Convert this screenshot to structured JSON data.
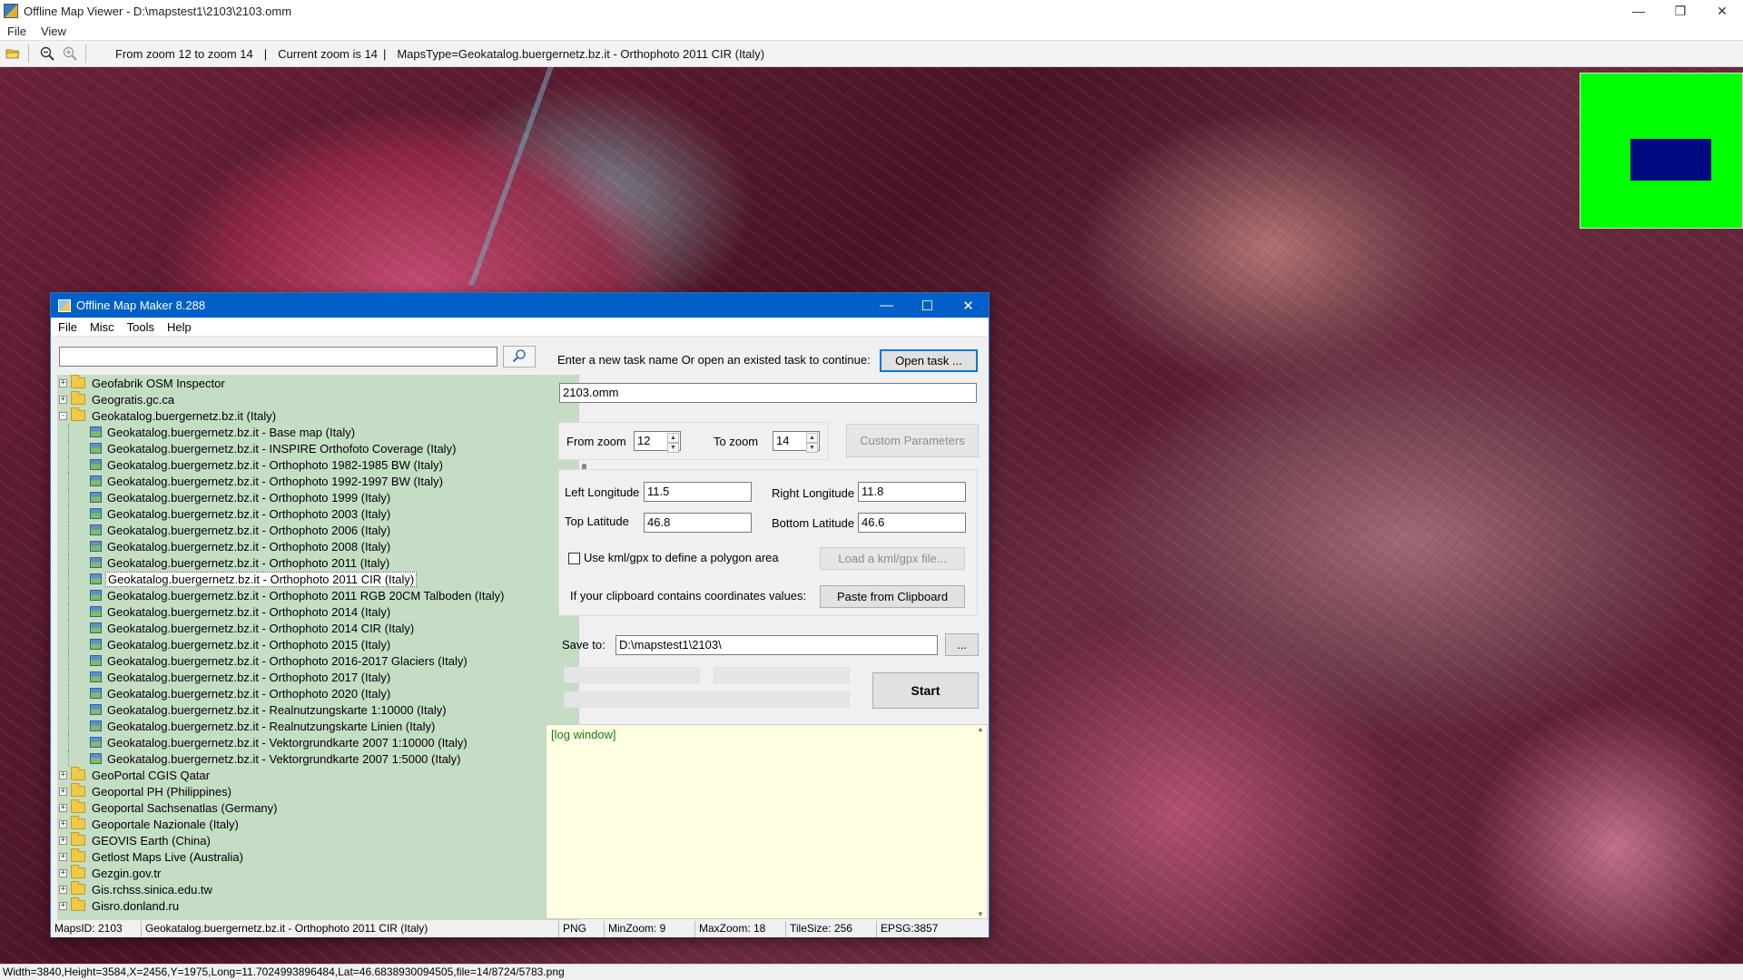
{
  "outer_window": {
    "title": "Offline Map Viewer - D:\\mapstest1\\2103\\2103.omm",
    "controls": [
      "—",
      "❐",
      "✕"
    ],
    "menu": [
      "File",
      "View"
    ]
  },
  "toolbar": {
    "zoom_range": "From zoom 12 to zoom 14",
    "current_zoom": "Current zoom is 14",
    "maps_type": "MapsType=Geokatalog.buergernetz.bz.it - Orthophoto 2011 CIR (Italy)",
    "sep": "|"
  },
  "status_bar": {
    "text": "Width=3840,Height=3584,X=2456,Y=1975,Long=11.7024993896484,Lat=46.6838930094505,file=14/8724/5783.png"
  },
  "dialog": {
    "title": "Offline Map Maker 8.288",
    "controls": [
      "—",
      "☐",
      "✕"
    ],
    "menu": [
      "File",
      "Misc",
      "Tools",
      "Help"
    ],
    "search": {
      "value": "",
      "placeholder": ""
    },
    "tree": {
      "top_groups": [
        {
          "label": "Geofabrik OSM Inspector",
          "expander": "+"
        },
        {
          "label": "Geogratis.gc.ca",
          "expander": "+"
        }
      ],
      "open_group": {
        "label": "Geokatalog.buergernetz.bz.it (Italy)",
        "expander": "-"
      },
      "children": [
        "Geokatalog.buergernetz.bz.it - Base map (Italy)",
        "Geokatalog.buergernetz.bz.it - INSPIRE Orthofoto Coverage (Italy)",
        "Geokatalog.buergernetz.bz.it - Orthophoto 1982-1985 BW (Italy)",
        "Geokatalog.buergernetz.bz.it - Orthophoto 1992-1997 BW (Italy)",
        "Geokatalog.buergernetz.bz.it - Orthophoto 1999 (Italy)",
        "Geokatalog.buergernetz.bz.it - Orthophoto 2003 (Italy)",
        "Geokatalog.buergernetz.bz.it - Orthophoto 2006 (Italy)",
        "Geokatalog.buergernetz.bz.it - Orthophoto 2008 (Italy)",
        "Geokatalog.buergernetz.bz.it - Orthophoto 2011 (Italy)",
        "Geokatalog.buergernetz.bz.it - Orthophoto 2011 CIR (Italy)",
        "Geokatalog.buergernetz.bz.it - Orthophoto 2011 RGB 20CM Talboden (Italy)",
        "Geokatalog.buergernetz.bz.it - Orthophoto 2014 (Italy)",
        "Geokatalog.buergernetz.bz.it - Orthophoto 2014 CIR (Italy)",
        "Geokatalog.buergernetz.bz.it - Orthophoto 2015 (Italy)",
        "Geokatalog.buergernetz.bz.it - Orthophoto 2016-2017 Glaciers (Italy)",
        "Geokatalog.buergernetz.bz.it - Orthophoto 2017 (Italy)",
        "Geokatalog.buergernetz.bz.it - Orthophoto 2020 (Italy)",
        "Geokatalog.buergernetz.bz.it - Realnutzungskarte 1:10000 (Italy)",
        "Geokatalog.buergernetz.bz.it - Realnutzungskarte Linien (Italy)",
        "Geokatalog.buergernetz.bz.it - Vektorgrundkarte 2007 1:10000 (Italy)",
        "Geokatalog.buergernetz.bz.it - Vektorgrundkarte 2007 1:5000 (Italy)"
      ],
      "bottom_groups": [
        {
          "label": "GeoPortal CGIS Qatar",
          "expander": "+"
        },
        {
          "label": "Geoportal PH (Philippines)",
          "expander": "+"
        },
        {
          "label": "Geoportal Sachsenatlas (Germany)",
          "expander": "+"
        },
        {
          "label": "Geoportale Nazionale (Italy)",
          "expander": "+"
        },
        {
          "label": "GEOVIS Earth (China)",
          "expander": "+"
        },
        {
          "label": "Getlost Maps Live (Australia)",
          "expander": "+"
        },
        {
          "label": "Gezgin.gov.tr",
          "expander": "+"
        },
        {
          "label": "Gis.rchss.sinica.edu.tw",
          "expander": "+"
        },
        {
          "label": "Gisro.donland.ru",
          "expander": "+"
        }
      ]
    },
    "task": {
      "prompt": "Enter a new task name Or open an existed task to continue:",
      "open_button": "Open task ...",
      "task_name": "2103.omm"
    },
    "zoom": {
      "from_label": "From zoom",
      "from_value": "12",
      "to_label": "To zoom",
      "to_value": "14",
      "custom_button": "Custom Parameters"
    },
    "coords": {
      "left_lon_label": "Left Longitude",
      "left_lon": "11.5",
      "right_lon_label": "Right Longitude",
      "right_lon": "11.8",
      "top_lat_label": "Top Latitude",
      "top_lat": "46.8",
      "bottom_lat_label": "Bottom Latitude",
      "bottom_lat": "46.6",
      "kml_label": "Use kml/gpx to define a polygon area",
      "kml_button": "Load a kml/gpx file...",
      "clipboard_label": "If your clipboard contains coordinates values:",
      "clipboard_button": "Paste from Clipboard"
    },
    "save": {
      "label": "Save to:",
      "path": "D:\\mapstest1\\2103\\",
      "browse": "..."
    },
    "start_button": "Start",
    "log_text": "[log window]",
    "status": {
      "maps_id": "MapsID: 2103",
      "maps_name": "Geokatalog.buergernetz.bz.it - Orthophoto 2011 CIR (Italy)",
      "format": "PNG",
      "min_zoom": "MinZoom: 9",
      "max_zoom": "MaxZoom: 18",
      "tile_size": "TileSize: 256",
      "epsg": "EPSG:3857"
    }
  }
}
